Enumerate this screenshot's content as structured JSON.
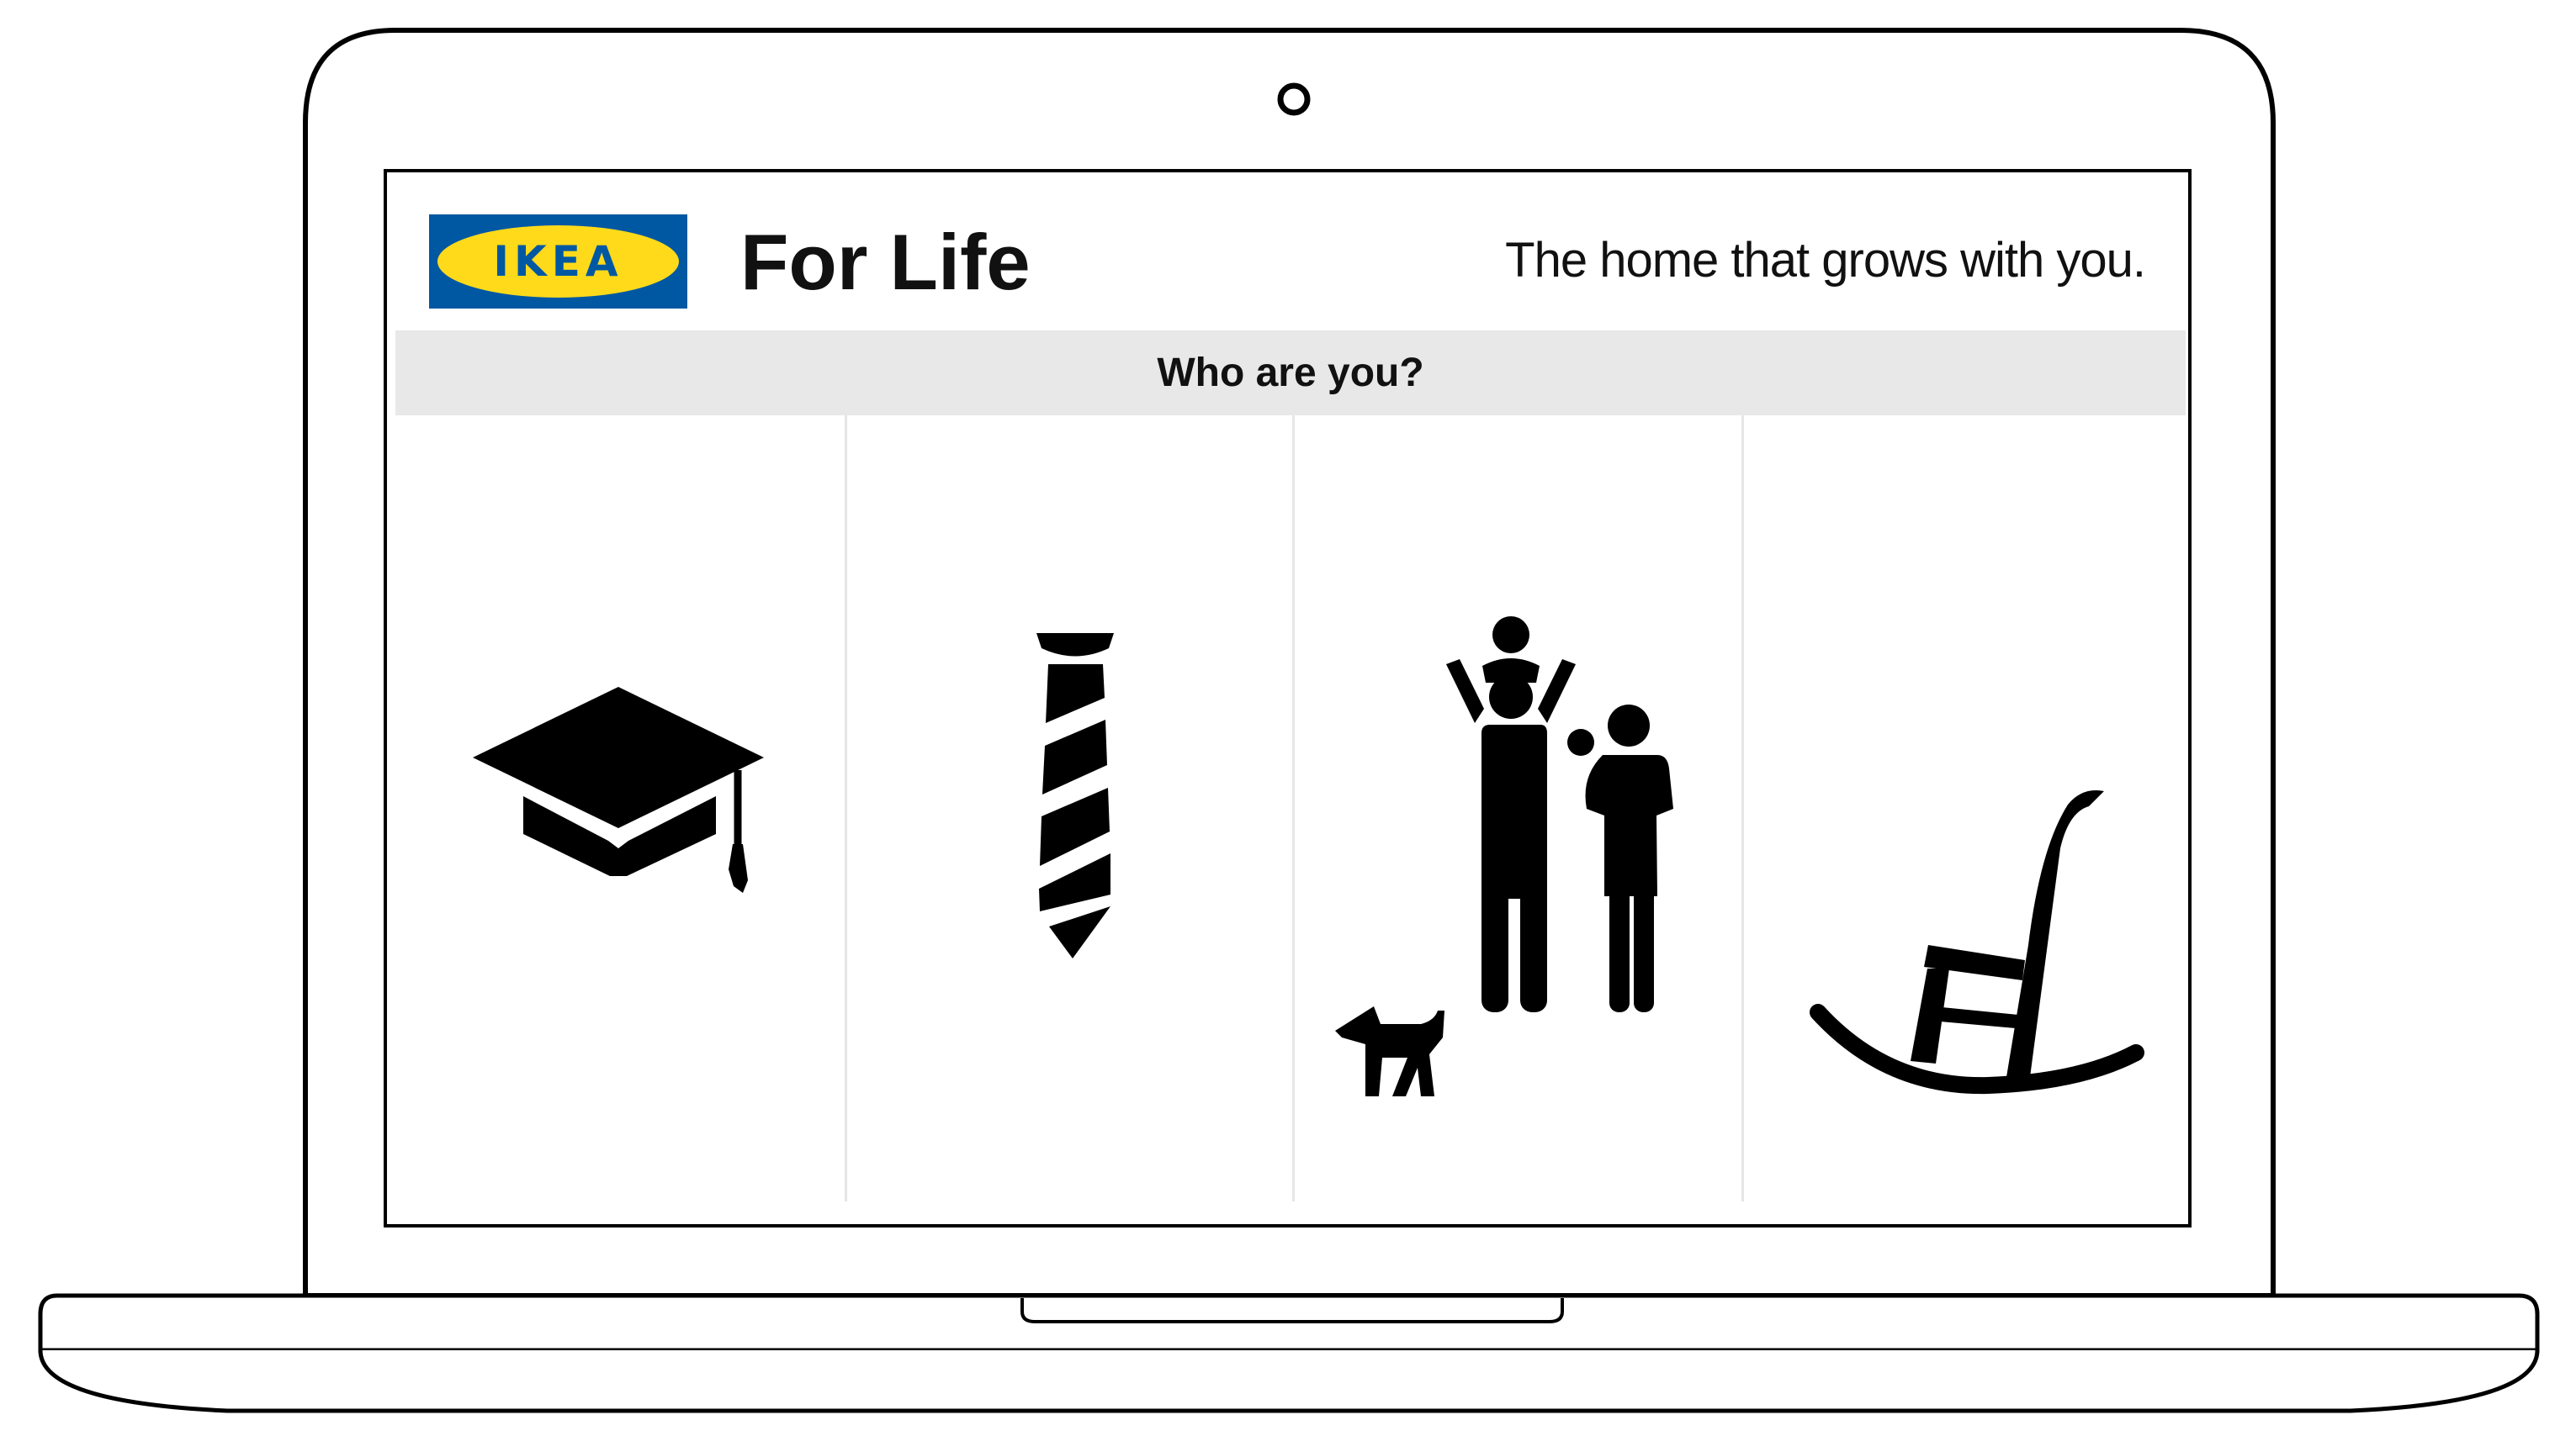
{
  "app": {
    "brand_logo_text": "IKEA",
    "title": "For Life",
    "tagline": "The home that grows with you."
  },
  "question": "Who are you?",
  "personas": [
    {
      "icon": "graduation-cap-icon"
    },
    {
      "icon": "necktie-icon"
    },
    {
      "icon": "family-with-dog-icon"
    },
    {
      "icon": "rocking-chair-icon"
    }
  ],
  "colors": {
    "brand_blue": "#0058a3",
    "brand_yellow": "#ffda1a",
    "question_bar": "#e8e8e8",
    "icon": "#000000"
  }
}
